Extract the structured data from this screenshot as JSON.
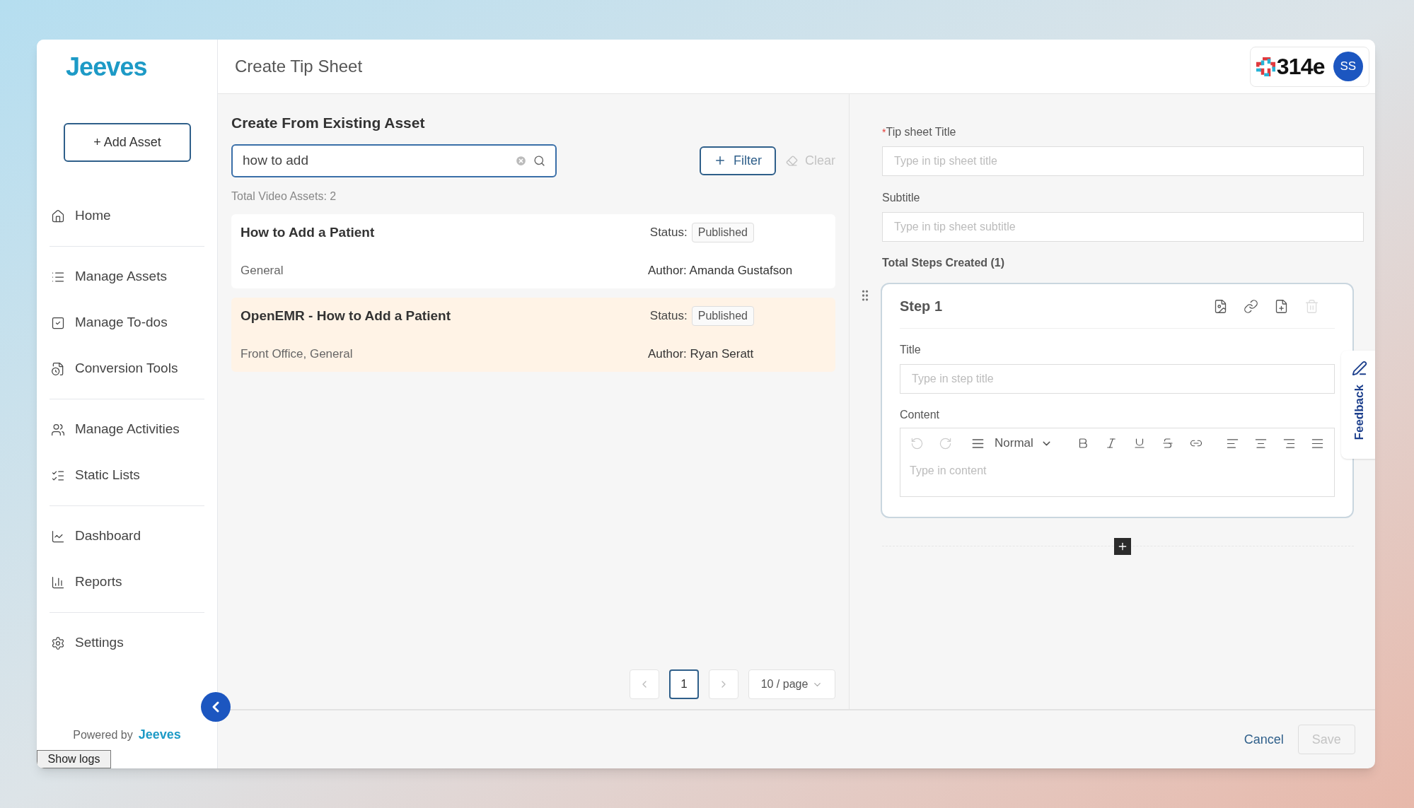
{
  "brand": "Jeeves",
  "sidebar": {
    "add_button": "+ Add Asset",
    "sections": [
      {
        "items": [
          {
            "label": "Home"
          }
        ]
      },
      {
        "items": [
          {
            "label": "Manage Assets"
          },
          {
            "label": "Manage To-dos"
          },
          {
            "label": "Conversion Tools"
          }
        ]
      },
      {
        "items": [
          {
            "label": "Manage Activities"
          },
          {
            "label": "Static Lists"
          }
        ]
      },
      {
        "items": [
          {
            "label": "Dashboard"
          },
          {
            "label": "Reports"
          }
        ]
      },
      {
        "items": [
          {
            "label": "Settings"
          }
        ]
      }
    ],
    "powered_by": "Powered by",
    "powered_brand": "Jeeves",
    "show_logs": "Show logs"
  },
  "header": {
    "title": "Create Tip Sheet",
    "org_logo": "314e",
    "avatar": "SS"
  },
  "asset_panel": {
    "heading": "Create From Existing Asset",
    "search": {
      "value": "how to add"
    },
    "filter": "Filter",
    "clear": "Clear",
    "total": "Total Video Assets: 2",
    "assets": [
      {
        "title": "How to Add a Patient",
        "status_label": "Status:",
        "status": "Published",
        "tags": "General",
        "author": "Author: Amanda Gustafson",
        "selected": false
      },
      {
        "title": "OpenEMR - How to Add a Patient",
        "status_label": "Status:",
        "status": "Published",
        "tags": "Front Office, General",
        "author": "Author: Ryan Seratt",
        "selected": true
      }
    ],
    "pagination": {
      "pages": [
        {
          "label": "1",
          "selected": true
        }
      ],
      "page_size": "10 / page"
    }
  },
  "form": {
    "title_label": "Tip sheet Title",
    "required_mark": "*",
    "title_placeholder": "Type in tip sheet title",
    "subtitle_label": "Subtitle",
    "subtitle_placeholder": "Type in tip sheet subtitle",
    "steps_count": "Total Steps Created (1)",
    "steps": [
      {
        "heading": "Step 1",
        "title_label": "Title",
        "title_placeholder": "Type in step title",
        "content_label": "Content",
        "text_style": "Normal",
        "content_placeholder": "Type in content"
      }
    ]
  },
  "feedback": "Feedback",
  "footer": {
    "cancel": "Cancel",
    "save": {
      "label": "Save",
      "disabled": true
    }
  }
}
